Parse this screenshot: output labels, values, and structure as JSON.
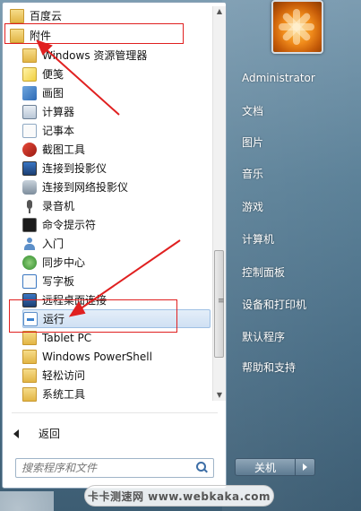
{
  "start_menu": {
    "programs": [
      {
        "label": "百度云",
        "icon": "folder-icon",
        "name": "program-baiduyun"
      },
      {
        "label": "附件",
        "icon": "folder-icon",
        "name": "program-accessories"
      },
      {
        "label": "Windows 资源管理器",
        "icon": "explorer-icon",
        "name": "program-windows-explorer"
      },
      {
        "label": "便笺",
        "icon": "sticky-notes-icon",
        "name": "program-sticky-notes"
      },
      {
        "label": "画图",
        "icon": "paint-icon",
        "name": "program-paint"
      },
      {
        "label": "计算器",
        "icon": "calculator-icon",
        "name": "program-calculator"
      },
      {
        "label": "记事本",
        "icon": "notepad-icon",
        "name": "program-notepad"
      },
      {
        "label": "截图工具",
        "icon": "snipping-tool-icon",
        "name": "program-snipping-tool"
      },
      {
        "label": "连接到投影仪",
        "icon": "projector-icon",
        "name": "program-connect-projector"
      },
      {
        "label": "连接到网络投影仪",
        "icon": "network-projector-icon",
        "name": "program-connect-network-projector"
      },
      {
        "label": "录音机",
        "icon": "microphone-icon",
        "name": "program-sound-recorder"
      },
      {
        "label": "命令提示符",
        "icon": "cmd-icon",
        "name": "program-command-prompt"
      },
      {
        "label": "入门",
        "icon": "getting-started-icon",
        "name": "program-getting-started"
      },
      {
        "label": "同步中心",
        "icon": "sync-center-icon",
        "name": "program-sync-center"
      },
      {
        "label": "写字板",
        "icon": "wordpad-icon",
        "name": "program-wordpad"
      },
      {
        "label": "远程桌面连接",
        "icon": "remote-desktop-icon",
        "name": "program-remote-desktop"
      },
      {
        "label": "运行",
        "icon": "run-icon",
        "name": "program-run"
      },
      {
        "label": "Tablet PC",
        "icon": "folder-icon",
        "name": "program-tablet-pc"
      },
      {
        "label": "Windows PowerShell",
        "icon": "folder-icon",
        "name": "program-powershell"
      },
      {
        "label": "轻松访问",
        "icon": "folder-icon",
        "name": "program-ease-of-access"
      },
      {
        "label": "系统工具",
        "icon": "folder-icon",
        "name": "program-system-tools"
      }
    ],
    "back_label": "返回",
    "search_placeholder": "搜索程序和文件"
  },
  "right_panel": {
    "items": [
      {
        "label": "Administrator",
        "name": "right-item-administrator"
      },
      {
        "label": "文档",
        "name": "right-item-documents"
      },
      {
        "label": "图片",
        "name": "right-item-pictures"
      },
      {
        "label": "音乐",
        "name": "right-item-music"
      },
      {
        "label": "游戏",
        "name": "right-item-games"
      },
      {
        "label": "计算机",
        "name": "right-item-computer"
      },
      {
        "label": "控制面板",
        "name": "right-item-control-panel"
      },
      {
        "label": "设备和打印机",
        "name": "right-item-devices-printers"
      },
      {
        "label": "默认程序",
        "name": "right-item-default-programs"
      },
      {
        "label": "帮助和支持",
        "name": "right-item-help-support"
      }
    ],
    "shutdown_label": "关机"
  },
  "watermark": "卡卡测速网 www.webkaka.com",
  "colors": {
    "annotation": "#e02020",
    "highlight": "#cfe0f3"
  }
}
